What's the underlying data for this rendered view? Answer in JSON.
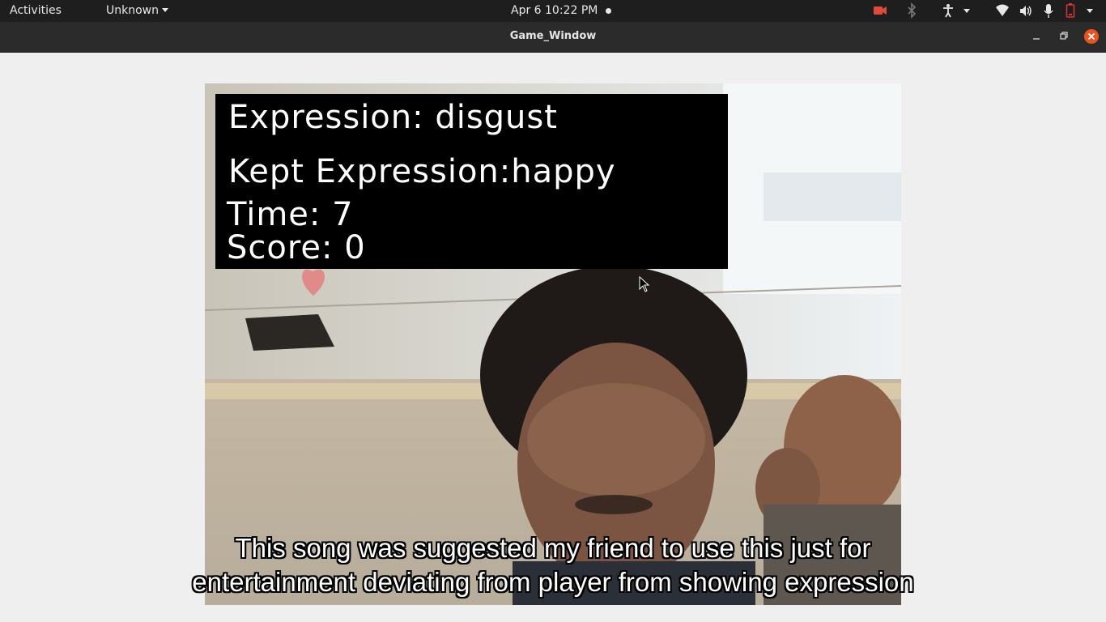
{
  "topbar": {
    "activities": "Activities",
    "app_menu": "Unknown",
    "clock": "Apr 6  10:22 PM"
  },
  "window": {
    "title": "Game_Window"
  },
  "game": {
    "expression_line": "Expression: disgust",
    "kept_line": "Kept Expression:happy",
    "time_line": "Time: 7",
    "score_line": "Score: 0"
  },
  "subtitles": {
    "line1": "This song was suggested my friend to use this just for",
    "line2": "entertainment deviating from player from showing expression"
  },
  "colors": {
    "accent": "#e95420",
    "overlay_bg": "#000000",
    "topbar_bg": "#1e1e1e"
  }
}
